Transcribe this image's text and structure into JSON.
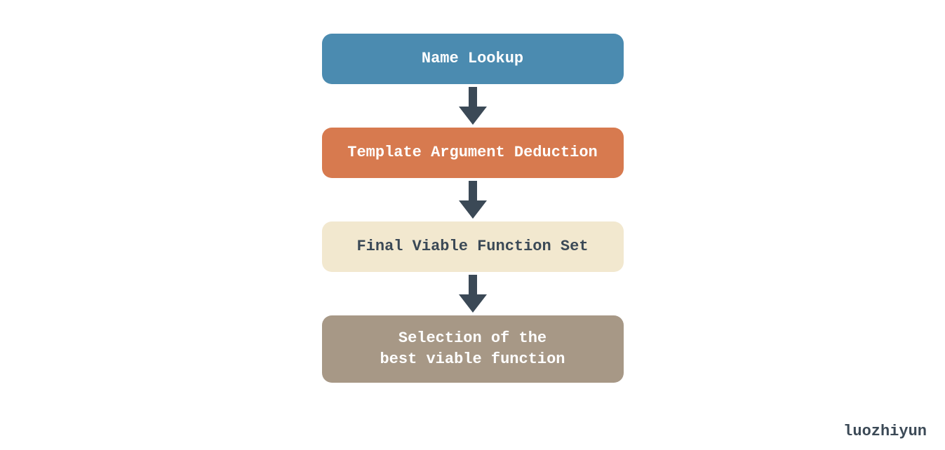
{
  "diagram": {
    "steps": [
      {
        "label": "Name Lookup",
        "bg": "#4b8bb0",
        "fg": "#ffffff"
      },
      {
        "label": "Template Argument Deduction",
        "bg": "#d77a4f",
        "fg": "#ffffff"
      },
      {
        "label": "Final Viable Function Set",
        "bg": "#f2e8cf",
        "fg": "#3b4956"
      },
      {
        "label": "Selection of the\nbest viable function",
        "bg": "#a79886",
        "fg": "#ffffff"
      }
    ],
    "arrow_color": "#3b4956"
  },
  "watermark": "luozhiyun"
}
